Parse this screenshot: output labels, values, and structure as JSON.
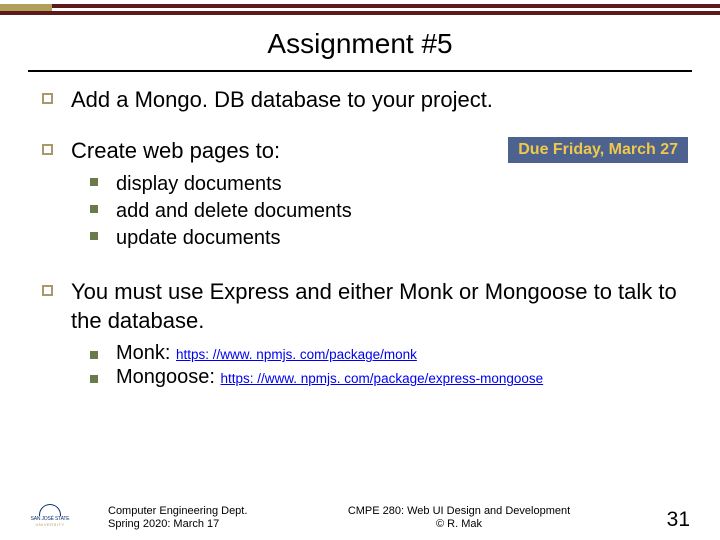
{
  "title": "Assignment #5",
  "bullets": [
    {
      "text": "Add a Mongo. DB database to your project."
    },
    {
      "text": "Create web pages to:",
      "due": "Due Friday, March 27",
      "sub": [
        "display documents",
        "add and delete documents",
        "update documents"
      ]
    },
    {
      "text": "You must use Express and either Monk or Mongoose to talk to the database.",
      "links": [
        {
          "label": "Monk: ",
          "url": "https: //www. npmjs. com/package/monk"
        },
        {
          "label": "Mongoose: ",
          "url": "https: //www. npmjs. com/package/express-mongoose"
        }
      ]
    }
  ],
  "footer": {
    "left1": "Computer Engineering Dept.",
    "left2": "Spring 2020: March 17",
    "center1": "CMPE 280: Web UI Design and Development",
    "center2": "© R. Mak",
    "page": "31"
  },
  "logo": {
    "line1": "SAN JOSÉ STATE",
    "line2": "UNIVERSITY"
  }
}
